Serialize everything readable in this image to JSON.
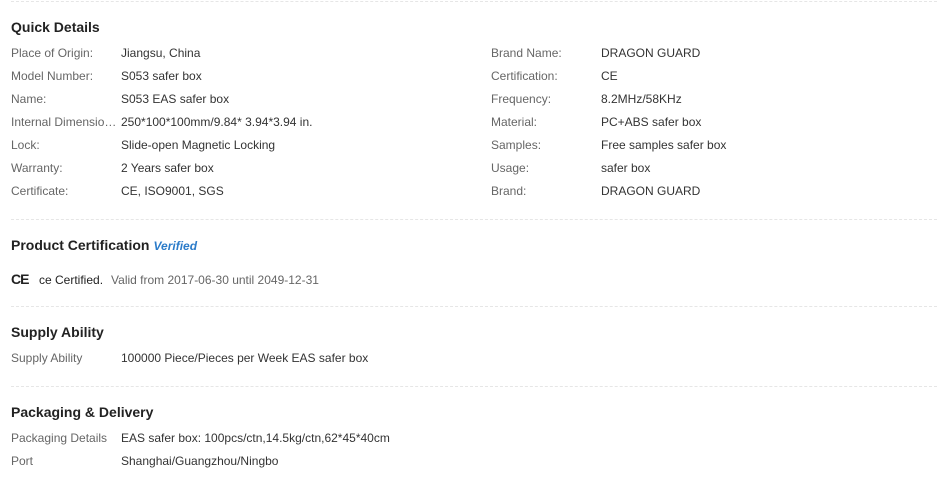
{
  "quick_details": {
    "title": "Quick Details",
    "left": [
      {
        "label": "Place of Origin:",
        "value": "Jiangsu, China"
      },
      {
        "label": "Model Number:",
        "value": "S053 safer box"
      },
      {
        "label": "Name:",
        "value": "S053 EAS safer box"
      },
      {
        "label": "Internal Dimension(...",
        "value": "250*100*100mm/9.84* 3.94*3.94 in."
      },
      {
        "label": "Lock:",
        "value": "Slide-open Magnetic Locking"
      },
      {
        "label": "Warranty:",
        "value": "2 Years safer box"
      },
      {
        "label": "Certificate:",
        "value": "CE, ISO9001, SGS"
      }
    ],
    "right": [
      {
        "label": "Brand Name:",
        "value": "DRAGON GUARD"
      },
      {
        "label": "Certification:",
        "value": "CE"
      },
      {
        "label": "Frequency:",
        "value": "8.2MHz/58KHz"
      },
      {
        "label": "Material:",
        "value": "PC+ABS safer box"
      },
      {
        "label": "Samples:",
        "value": "Free samples safer box"
      },
      {
        "label": "Usage:",
        "value": "safer box"
      },
      {
        "label": "Brand:",
        "value": "DRAGON GUARD"
      }
    ]
  },
  "product_certification": {
    "title": "Product Certification",
    "verified_label": "Verified",
    "icon": "ce-mark-icon",
    "icon_text": "CE",
    "cert_name": "ce Certified.",
    "validity": "Valid from 2017-06-30 until 2049-12-31"
  },
  "supply_ability": {
    "title": "Supply Ability",
    "rows": [
      {
        "label": "Supply Ability",
        "value": "100000 Piece/Pieces per Week EAS safer box"
      }
    ]
  },
  "packaging_delivery": {
    "title": "Packaging & Delivery",
    "rows": [
      {
        "label": "Packaging Details",
        "value": "EAS safer box: 100pcs/ctn,14.5kg/ctn,62*45*40cm"
      },
      {
        "label": "Port",
        "value": "Shanghai/Guangzhou/Ningbo"
      }
    ]
  }
}
